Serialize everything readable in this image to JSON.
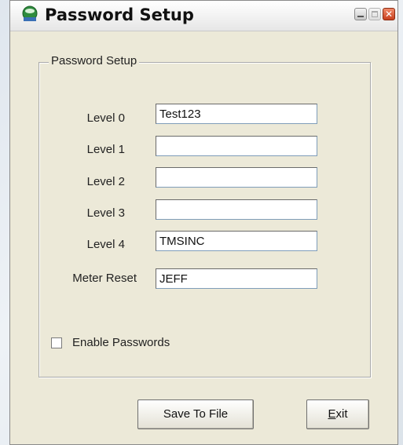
{
  "window": {
    "title": "Password Setup",
    "close_glyph": "✕"
  },
  "group": {
    "label": "Password Setup"
  },
  "fields": [
    {
      "label": "Level 0",
      "value": "Test123"
    },
    {
      "label": "Level 1",
      "value": ""
    },
    {
      "label": "Level 2",
      "value": ""
    },
    {
      "label": "Level 3",
      "value": ""
    },
    {
      "label": "Level 4",
      "value": "TMSINC"
    },
    {
      "label": "Meter Reset",
      "value": "JEFF"
    }
  ],
  "enable_passwords": {
    "label": "Enable Passwords",
    "checked": false
  },
  "buttons": {
    "save_label": "Save To File",
    "exit_label_first": "E",
    "exit_label_rest": "xit"
  }
}
